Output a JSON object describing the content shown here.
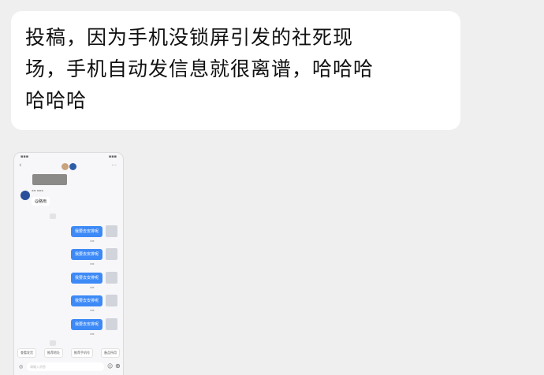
{
  "post": {
    "lines": [
      "投稿，因为手机没锁屏引发的社死现",
      "场，手机自动发信息就很离谱，哈哈哈",
      "哈哈哈"
    ]
  },
  "screenshot": {
    "messages": [
      {
        "text": "我要去安排呢"
      },
      {
        "text": "我要去安排呢"
      },
      {
        "text": "我要去安排呢"
      },
      {
        "text": "我要去安排呢"
      },
      {
        "text": "我要去安排呢"
      }
    ],
    "received": {
      "text": "@路雨"
    },
    "input_placeholder": "请输入消息",
    "chips": [
      "查看发货",
      "推荐地址",
      "推荐手机号",
      "备品所用"
    ]
  },
  "colors": {
    "page_background": "#efefef",
    "bubble": "#ffffff",
    "sent_bubble": "#3d8af7"
  }
}
